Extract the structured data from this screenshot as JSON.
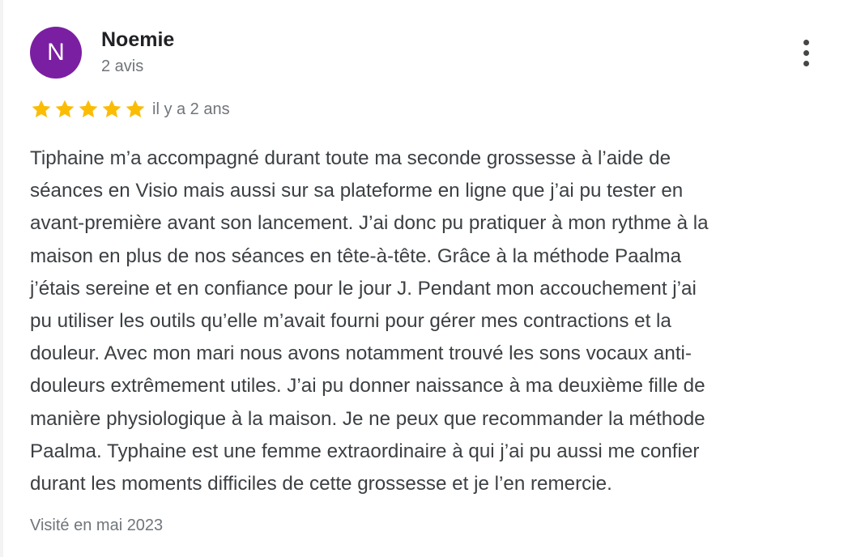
{
  "review": {
    "author": {
      "initial": "N",
      "name": "Noemie",
      "reviews_count": "2 avis",
      "avatar_color": "#7b1fa2"
    },
    "rating": 5,
    "star_color": "#fbbc04",
    "date": "il y a 2 ans",
    "text": "Tiphaine m’a accompagné durant toute ma seconde grossesse à l’aide de\nséances en Visio mais aussi sur sa plateforme en ligne que j’ai pu tester en\navant-première avant son lancement. J’ai donc pu pratiquer à mon rythme à la\nmaison en plus de nos séances en tête-à-tête. Grâce à la méthode Paalma\nj’étais sereine et en confiance pour le jour J. Pendant mon accouchement j’ai\npu utiliser les outils qu’elle m’avait fourni pour gérer mes contractions et la\ndouleur. Avec mon mari nous avons notamment trouvé les sons vocaux anti-\ndouleurs extrêmement utiles. J’ai pu donner naissance à ma deuxième fille de\nmanière physiologique à la maison. Je ne peux que recommander la méthode\nPaalma. Typhaine est une femme extraordinaire à qui j’ai pu aussi me confier\ndurant les moments difficiles de cette grossesse et je l’en remercie.",
    "visit": "Visité en mai 2023",
    "menu_icon": "more-vert-icon"
  }
}
